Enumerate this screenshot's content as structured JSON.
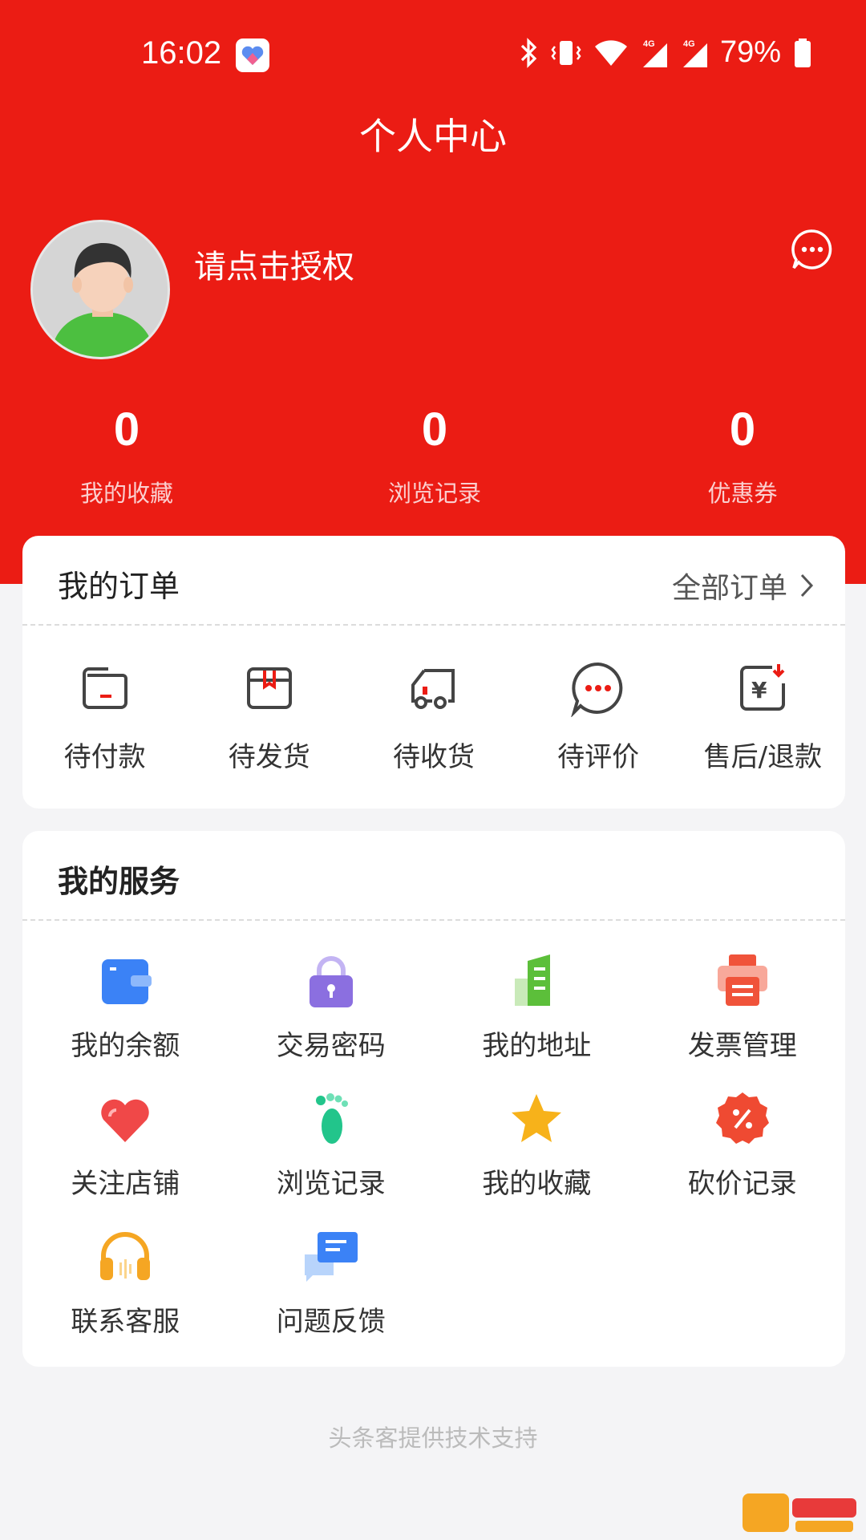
{
  "status_bar": {
    "time": "16:02",
    "battery": "79%",
    "network": "4G"
  },
  "header": {
    "title": "个人中心",
    "user_name": "请点击授权",
    "brand_color": "#eb1c14"
  },
  "stats": [
    {
      "value": "0",
      "label": "我的收藏"
    },
    {
      "value": "0",
      "label": "浏览记录"
    },
    {
      "value": "0",
      "label": "优惠券"
    }
  ],
  "orders": {
    "title": "我的订单",
    "more_label": "全部订单",
    "items": [
      {
        "label": "待付款",
        "icon": "wallet-icon"
      },
      {
        "label": "待发货",
        "icon": "box-icon"
      },
      {
        "label": "待收货",
        "icon": "truck-icon"
      },
      {
        "label": "待评价",
        "icon": "comment-icon"
      },
      {
        "label": "售后/退款",
        "icon": "refund-icon"
      }
    ]
  },
  "services": {
    "title": "我的服务",
    "items": [
      {
        "label": "我的余额",
        "icon": "wallet-icon",
        "color": "#3b82f6"
      },
      {
        "label": "交易密码",
        "icon": "lock-icon",
        "color": "#8b6fe0"
      },
      {
        "label": "我的地址",
        "icon": "building-icon",
        "color": "#5cbf3a"
      },
      {
        "label": "发票管理",
        "icon": "printer-icon",
        "color": "#f0533a"
      },
      {
        "label": "关注店铺",
        "icon": "heart-icon",
        "color": "#f04848"
      },
      {
        "label": "浏览记录",
        "icon": "footprint-icon",
        "color": "#22c58b"
      },
      {
        "label": "我的收藏",
        "icon": "star-icon",
        "color": "#f7b21a"
      },
      {
        "label": "砍价记录",
        "icon": "discount-icon",
        "color": "#ef4a32"
      },
      {
        "label": "联系客服",
        "icon": "headset-icon",
        "color": "#f5a623"
      },
      {
        "label": "问题反馈",
        "icon": "feedback-icon",
        "color": "#3b82f6"
      }
    ]
  },
  "footer": {
    "text": "头条客提供技术支持"
  }
}
